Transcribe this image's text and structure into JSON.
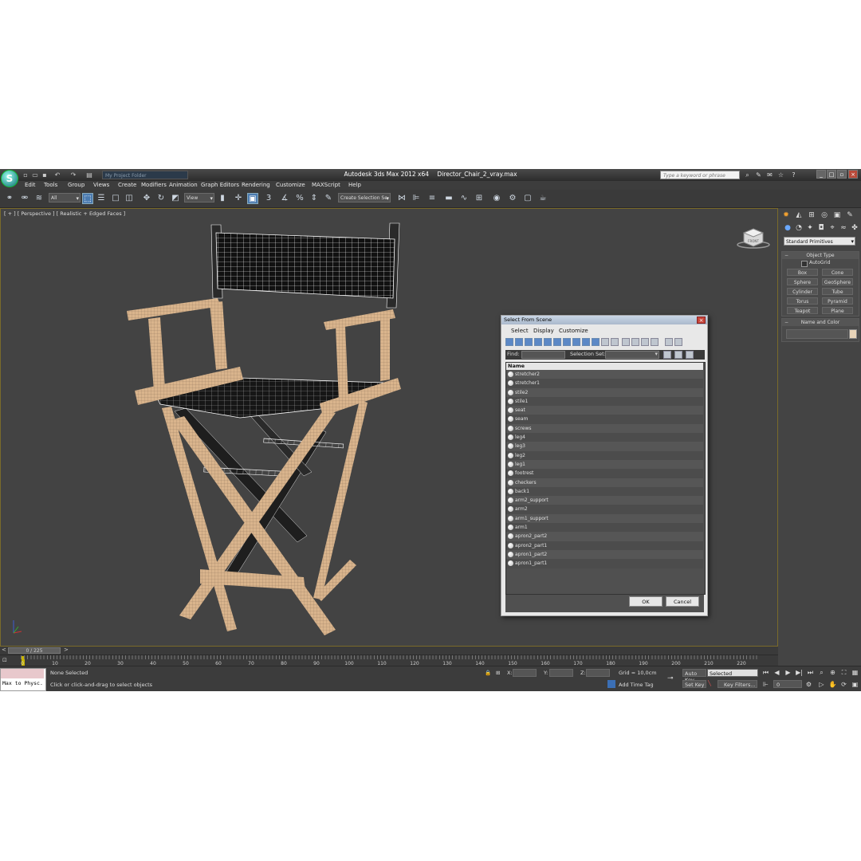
{
  "window": {
    "app_title": "Autodesk 3ds Max  2012 x64",
    "file_name": "Director_Chair_2_vray.max",
    "project_folder_placeholder": "My Project Folder",
    "search_placeholder": "Type a keyword or phrase"
  },
  "menubar": [
    "Edit",
    "Tools",
    "Group",
    "Views",
    "Create",
    "Modifiers",
    "Animation",
    "Graph Editors",
    "Rendering",
    "Customize",
    "MAXScript",
    "Help"
  ],
  "toolbar": {
    "selection_filter": "All",
    "reference_coord": "View",
    "named_selection": "Create Selection Se",
    "snap_label": "3"
  },
  "viewport": {
    "label": "[ + ] [ Perspective ] [ Realistic + Edged Faces ]",
    "viewcube_label": "FRONT",
    "colors": {
      "wood": "#d9b48c",
      "wireframe": "#ffffff",
      "background": "#434343"
    }
  },
  "dialog": {
    "title": "Select From Scene",
    "menu": [
      "Select",
      "Display",
      "Customize"
    ],
    "find_label": "Find:",
    "selection_set_label": "Selection Set:",
    "column_name": "Name",
    "objects": [
      "stretcher2",
      "stretcher1",
      "stile2",
      "stile1",
      "seat",
      "seam",
      "screws",
      "leg4",
      "leg3",
      "leg2",
      "leg1",
      "footrest",
      "checkers",
      "back1",
      "arm2_support",
      "arm2",
      "arm1_support",
      "arm1",
      "apron2_part2",
      "apron2_part1",
      "apron1_part2",
      "apron1_part1"
    ],
    "ok_label": "OK",
    "cancel_label": "Cancel"
  },
  "command_panel": {
    "category": "Standard Primitives",
    "object_type_title": "Object Type",
    "autogrid_label": "AutoGrid",
    "buttons": [
      "Box",
      "Cone",
      "Sphere",
      "GeoSphere",
      "Cylinder",
      "Tube",
      "Torus",
      "Pyramid",
      "Teapot",
      "Plane"
    ],
    "name_color_title": "Name and Color"
  },
  "timeline": {
    "frame_display": "0 / 225",
    "ticks": [
      "0",
      "10",
      "20",
      "30",
      "40",
      "50",
      "60",
      "70",
      "80",
      "90",
      "100",
      "110",
      "120",
      "130",
      "140",
      "150",
      "160",
      "170",
      "180",
      "190",
      "200",
      "210",
      "220"
    ]
  },
  "status": {
    "maxscript_text": "Max to Physc.",
    "selection_status": "None Selected",
    "prompt": "Click or click-and-drag to select objects",
    "x_label": "X:",
    "y_label": "Y:",
    "z_label": "Z:",
    "grid": "Grid = 10,0cm",
    "add_time_tag": "Add Time Tag",
    "auto_key": "Auto Key",
    "auto_key_mode": "Selected",
    "set_key": "Set Key",
    "key_filters": "Key Filters...",
    "frame": "0"
  }
}
